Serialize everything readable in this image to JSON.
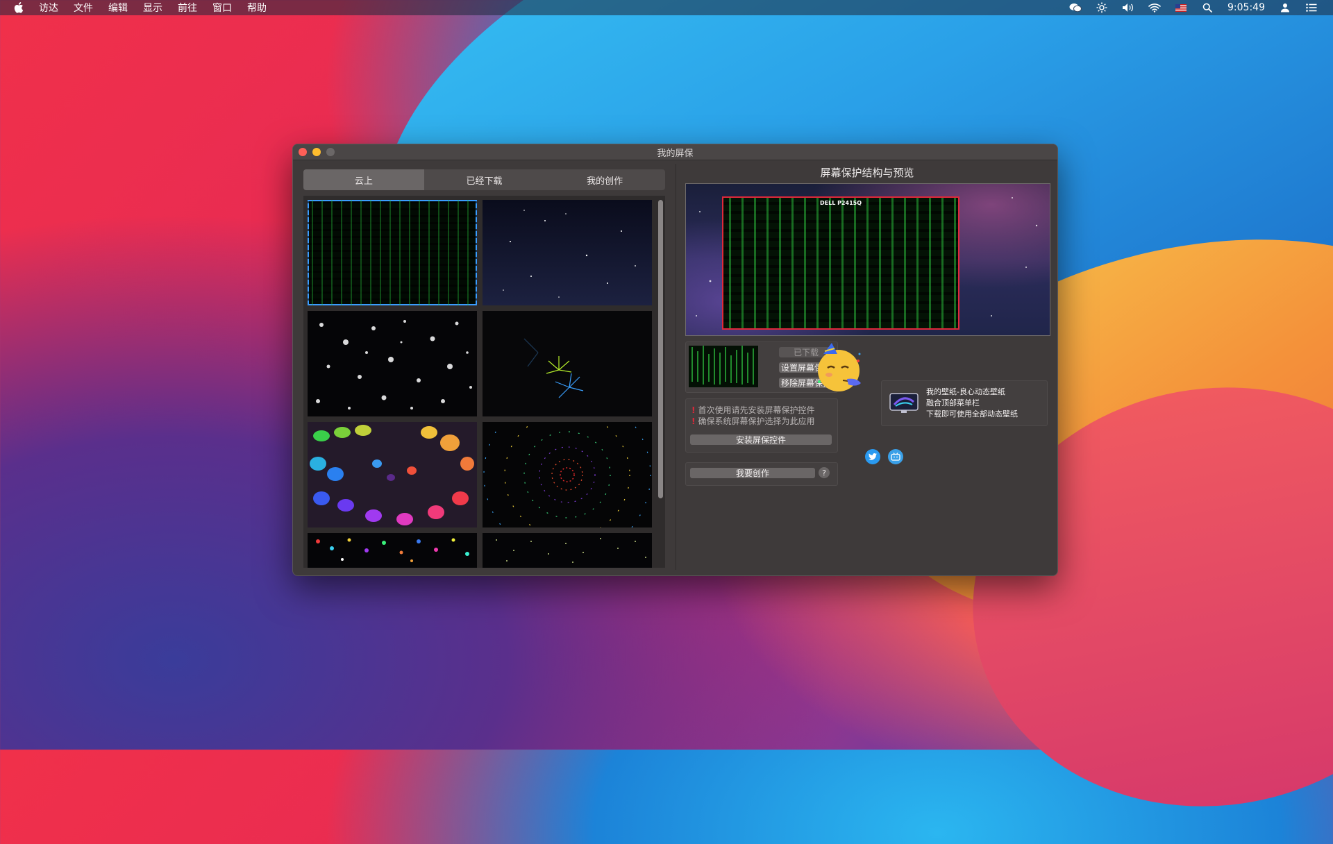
{
  "menubar": {
    "items": [
      "访达",
      "文件",
      "编辑",
      "显示",
      "前往",
      "窗口",
      "帮助"
    ],
    "clock": "9:05:49"
  },
  "window": {
    "title": "我的屏保",
    "tabs": [
      "云上",
      "已经下载",
      "我的创作"
    ],
    "right_title": "屏幕保护结构与预览",
    "monitor_label": "DELL P2415Q",
    "buttons": {
      "downloaded": "已下载",
      "set": "设置屏幕保护",
      "remove": "移除屏幕保护",
      "install": "安装屏保控件",
      "create": "我要创作"
    },
    "notes": [
      "首次使用请先安装屏幕保护控件",
      "确保系统屏幕保护选择为此应用"
    ],
    "promo": [
      "我的壁纸-良心动态壁纸",
      "融合顶部菜单栏",
      "下载即可使用全部动态壁纸"
    ],
    "help": "?"
  },
  "colors": {
    "accent": "#3a9cff",
    "close": "#fe5f57",
    "minimize": "#febc2e",
    "warning": "#e0283a"
  }
}
